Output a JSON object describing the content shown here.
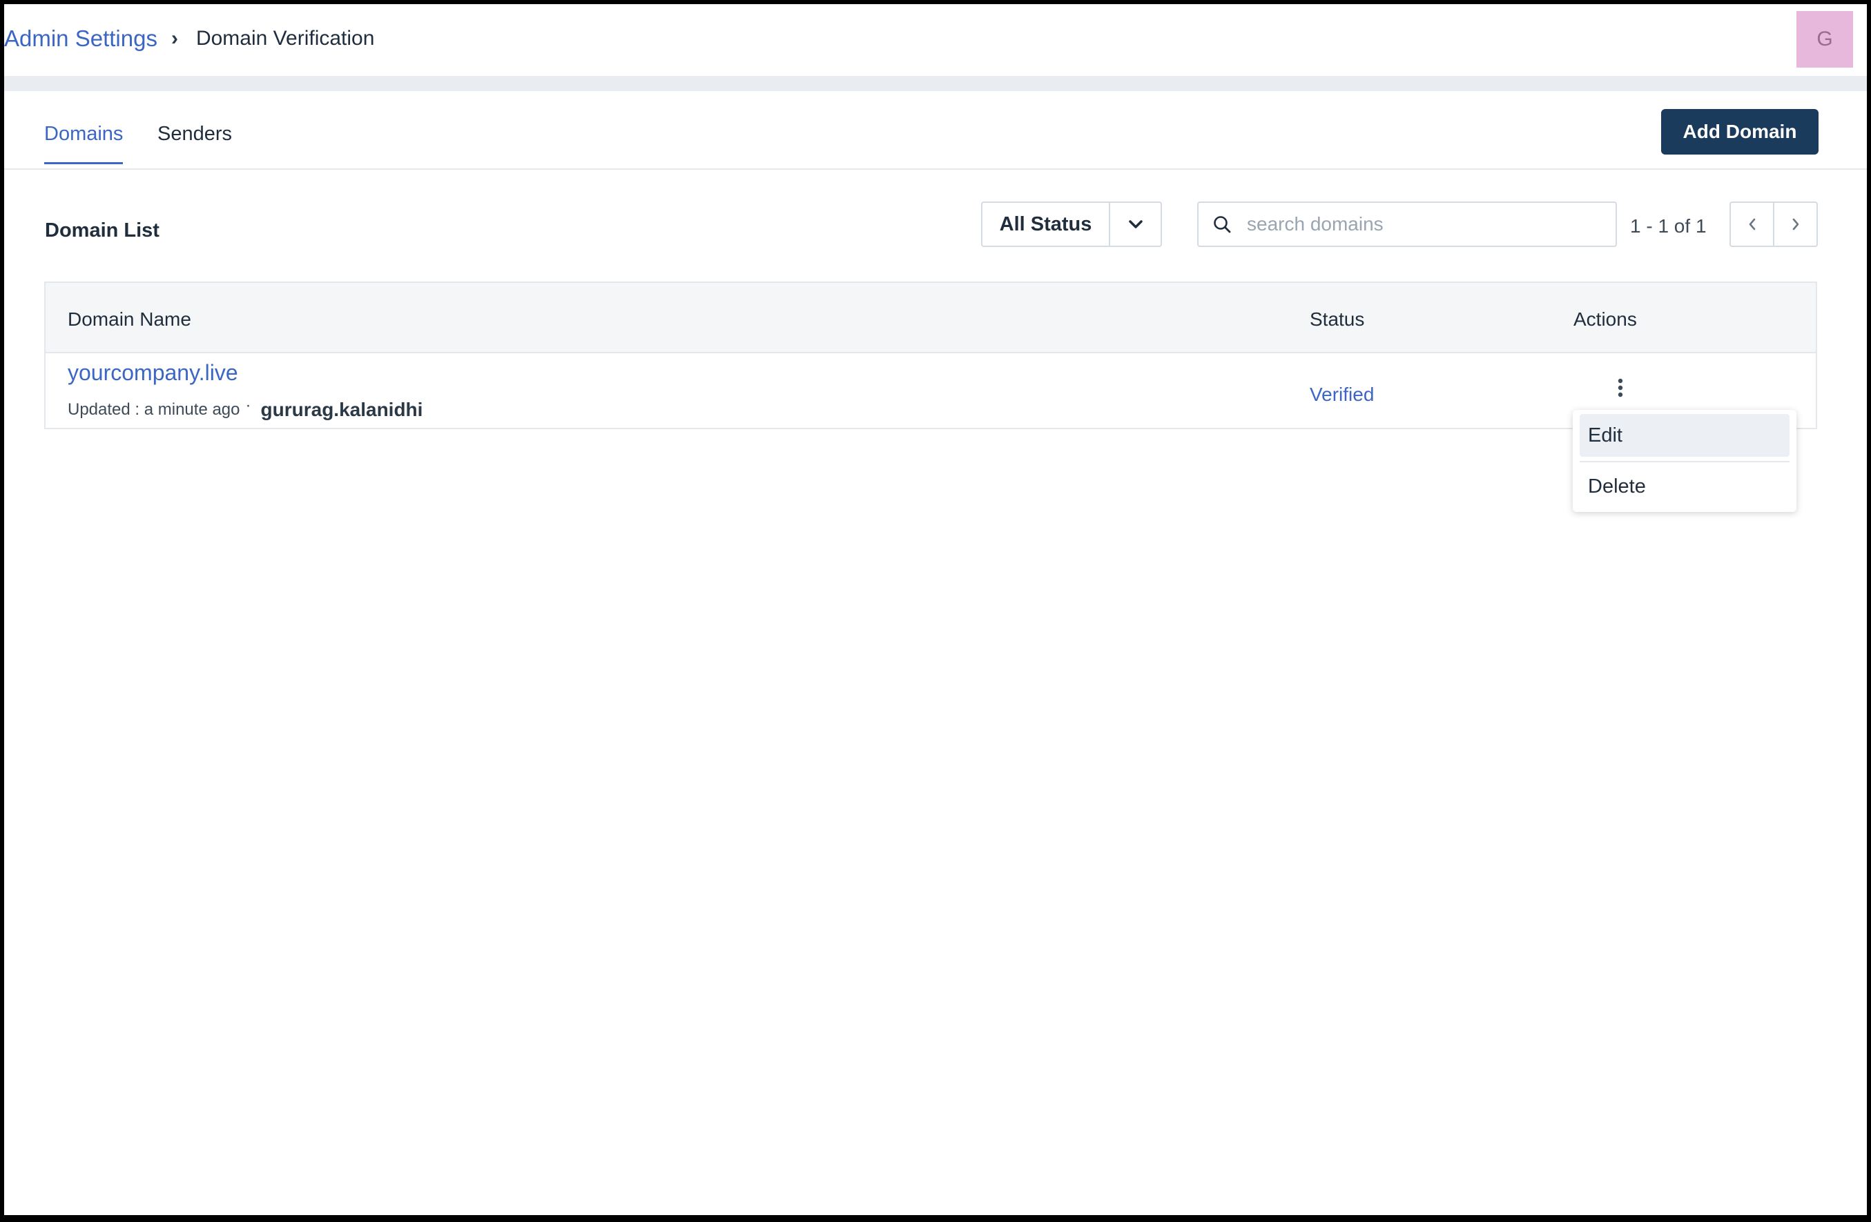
{
  "header": {
    "breadcrumb_root": "Admin Settings",
    "breadcrumb_separator": "›",
    "breadcrumb_current": "Domain Verification",
    "avatar_initial": "G"
  },
  "tabs": [
    {
      "label": "Domains",
      "active": true
    },
    {
      "label": "Senders",
      "active": false
    }
  ],
  "actions": {
    "add_domain_label": "Add Domain"
  },
  "toolbar": {
    "list_title": "Domain List",
    "status_filter": {
      "selected": "All Status",
      "icon": "chevron-down-icon"
    },
    "search": {
      "placeholder": "search domains",
      "value": "",
      "icon": "search-icon"
    },
    "pagination": {
      "range_text": "1 - 1 of 1",
      "prev_icon": "chevron-left-icon",
      "next_icon": "chevron-right-icon"
    }
  },
  "table": {
    "columns": [
      "Domain Name",
      "Status",
      "Actions"
    ],
    "rows": [
      {
        "domain": "yourcompany.live",
        "updated": "Updated : a minute ago",
        "separator": "·",
        "user": "gururag.kalanidhi",
        "status": "Verified",
        "actions_icon": "kebab-menu-icon"
      }
    ]
  },
  "row_menu": {
    "items": [
      "Edit",
      "Delete"
    ],
    "highlighted": "Edit"
  },
  "colors": {
    "accent": "#3b66c4",
    "primary_button": "#1b3b5c",
    "avatar_bg": "#e7b7dc",
    "header_band": "#e9ecf0",
    "table_header_bg": "#f4f6f8"
  }
}
